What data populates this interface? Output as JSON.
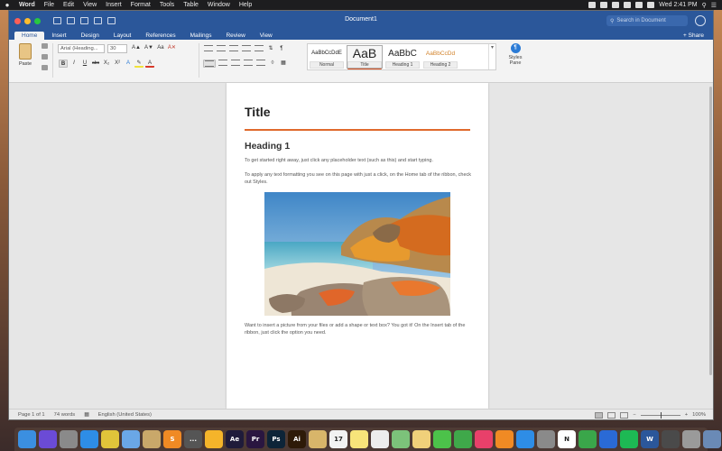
{
  "menubar": {
    "app_name": "Word",
    "items": [
      "File",
      "Edit",
      "View",
      "Insert",
      "Format",
      "Tools",
      "Table",
      "Window",
      "Help"
    ],
    "clock": "Wed 2:41 PM"
  },
  "window": {
    "title": "Document1",
    "search_placeholder": "Search in Document",
    "share_label": "Share"
  },
  "tabs": [
    "Home",
    "Insert",
    "Design",
    "Layout",
    "References",
    "Mailings",
    "Review",
    "View"
  ],
  "ribbon": {
    "paste_label": "Paste",
    "font_name": "Arial (Heading...",
    "font_size": "30",
    "format_buttons": [
      "B",
      "I",
      "U",
      "abc",
      "X₂",
      "X²"
    ],
    "styles": [
      {
        "sample": "AaBbCcDdE",
        "name": "Normal"
      },
      {
        "sample": "AaB",
        "name": "Title"
      },
      {
        "sample": "AaBbC",
        "name": "Heading 1"
      },
      {
        "sample": "AaBbCcDd",
        "name": "Heading 2"
      }
    ],
    "styles_pane_label": "Styles Pane"
  },
  "document": {
    "title": "Title",
    "heading1": "Heading 1",
    "para1": "To get started right away, just click any placeholder text (such as this) and start typing.",
    "para2": "To apply any text formatting you see on this page with just a click, on the Home tab of the ribbon, check out Styles.",
    "para3": "Want to insert a picture from your files or add a shape or text box? You got it! On the Insert tab of the ribbon, just click the option you need."
  },
  "statusbar": {
    "page": "Page 1 of 1",
    "words": "74 words",
    "language": "English (United States)",
    "zoom": "100%"
  },
  "colors": {
    "word_blue": "#2b579a",
    "title_rule": "#e06a2c"
  },
  "dock": [
    {
      "name": "finder-icon",
      "label": "",
      "color": "#3b8fe0"
    },
    {
      "name": "siri-icon",
      "label": "",
      "color": "#6b4bd6"
    },
    {
      "name": "launchpad-icon",
      "label": "",
      "color": "#8a8a8a"
    },
    {
      "name": "safari-icon",
      "label": "",
      "color": "#2e8de6"
    },
    {
      "name": "chrome-icon",
      "label": "",
      "color": "#e0c43a"
    },
    {
      "name": "mail-icon",
      "label": "",
      "color": "#6aa7e6"
    },
    {
      "name": "preview-icon",
      "label": "",
      "color": "#c9a86a"
    },
    {
      "name": "sublime-icon",
      "label": "S",
      "color": "#f08a24"
    },
    {
      "name": "more-icon",
      "label": "...",
      "color": "#555555"
    },
    {
      "name": "sketch-icon",
      "label": "",
      "color": "#f5b42a"
    },
    {
      "name": "after-effects-icon",
      "label": "Ae",
      "color": "#1f1b3a"
    },
    {
      "name": "premiere-icon",
      "label": "Pr",
      "color": "#2a1640"
    },
    {
      "name": "photoshop-icon",
      "label": "Ps",
      "color": "#0d2438"
    },
    {
      "name": "illustrator-icon",
      "label": "Ai",
      "color": "#2e1a08"
    },
    {
      "name": "notes-icon",
      "label": "",
      "color": "#d8b56a"
    },
    {
      "name": "calendar-icon",
      "label": "17",
      "color": "#f2f2f2"
    },
    {
      "name": "notes-app-icon",
      "label": "",
      "color": "#f7e47a"
    },
    {
      "name": "reminders-icon",
      "label": "",
      "color": "#ededed"
    },
    {
      "name": "maps-icon",
      "label": "",
      "color": "#7cc27a"
    },
    {
      "name": "photos-icon",
      "label": "",
      "color": "#f0d07a"
    },
    {
      "name": "messages-icon",
      "label": "",
      "color": "#4cc24a"
    },
    {
      "name": "facetime-icon",
      "label": "",
      "color": "#3fa84a"
    },
    {
      "name": "music-icon",
      "label": "",
      "color": "#e8406a"
    },
    {
      "name": "books-icon",
      "label": "",
      "color": "#f08a24"
    },
    {
      "name": "app-store-icon",
      "label": "",
      "color": "#2e8de6"
    },
    {
      "name": "system-preferences-icon",
      "label": "",
      "color": "#8a8a8a"
    },
    {
      "name": "notion-icon",
      "label": "N",
      "color": "#ffffff"
    },
    {
      "name": "evernote-icon",
      "label": "",
      "color": "#3aa64a"
    },
    {
      "name": "app-icon-blue",
      "label": "",
      "color": "#2a6ad6"
    },
    {
      "name": "spotify-icon",
      "label": "",
      "color": "#1db954"
    },
    {
      "name": "word-icon",
      "label": "W",
      "color": "#2b579a"
    },
    {
      "name": "app-icon-dark",
      "label": "",
      "color": "#4a4a4a"
    },
    {
      "name": "app-icon-gray",
      "label": "",
      "color": "#9a9a9a"
    },
    {
      "name": "downloads-icon",
      "label": "",
      "color": "#6a8ab6"
    },
    {
      "name": "trash-icon",
      "label": "",
      "color": "#b0b0b0"
    }
  ]
}
